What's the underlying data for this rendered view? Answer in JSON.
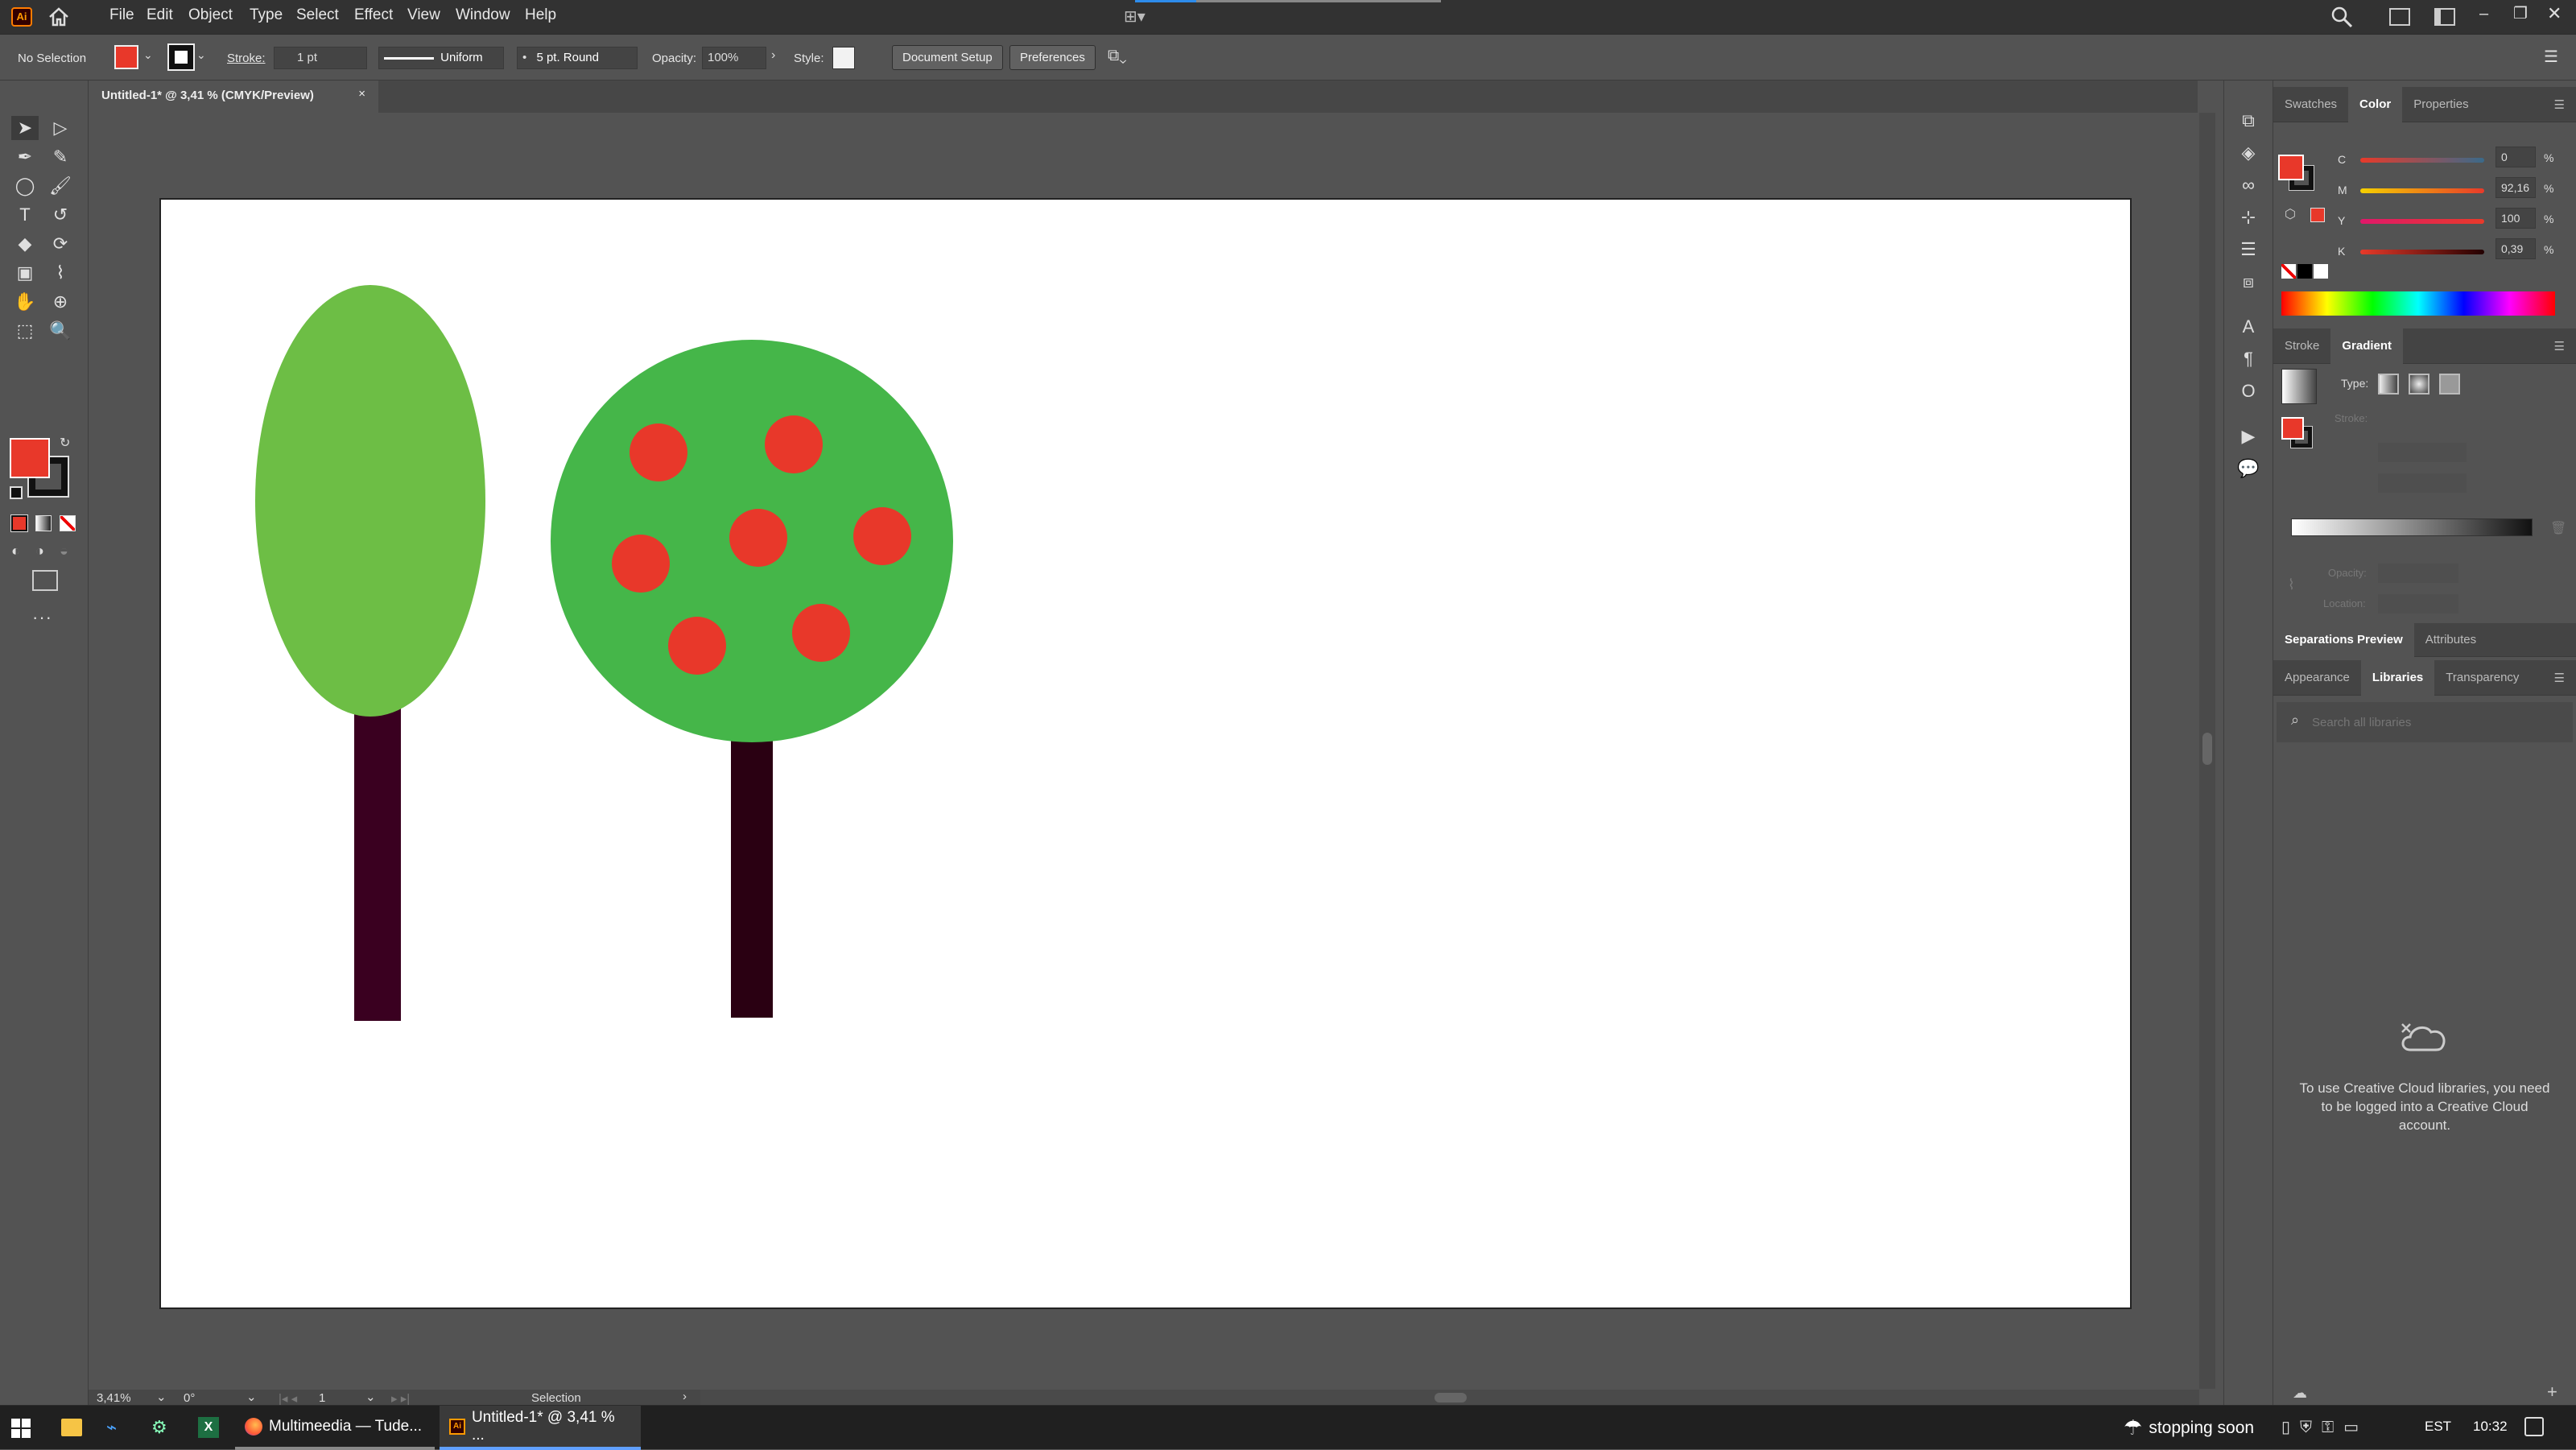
{
  "app": {
    "logo": "Ai"
  },
  "menu": [
    "File",
    "Edit",
    "Object",
    "Type",
    "Select",
    "Effect",
    "View",
    "Window",
    "Help"
  ],
  "control": {
    "selection": "No Selection",
    "stroke_label": "Stroke:",
    "stroke_value": "1 pt",
    "profile": "Uniform",
    "brush": "5 pt. Round",
    "opacity_label": "Opacity:",
    "opacity_value": "100%",
    "style_label": "Style:",
    "doc_setup": "Document Setup",
    "preferences": "Preferences"
  },
  "document": {
    "tab": "Untitled-1* @ 3,41 % (CMYK/Preview)"
  },
  "colors": {
    "fill": "#E8382A",
    "leaf_light": "#6DBE45",
    "leaf_dark": "#45B649",
    "trunk1": "#3A0020",
    "trunk2": "#2A0012",
    "fruit": "#E8382A"
  },
  "panels": {
    "top_tabs": [
      "Swatches",
      "Color",
      "Properties"
    ],
    "color": {
      "c": "0",
      "m": "92,16",
      "y": "100",
      "k": "0,39",
      "c_label": "C",
      "m_label": "M",
      "y_label": "Y",
      "k_label": "K",
      "pct": "%"
    },
    "mid_tabs": [
      "Stroke",
      "Gradient"
    ],
    "gradient": {
      "type_label": "Type:",
      "stroke_label": "Stroke:",
      "opacity_label": "Opacity:",
      "location_label": "Location:"
    },
    "sep_tabs": [
      "Separations Preview",
      "Attributes"
    ],
    "lib_tabs": [
      "Appearance",
      "Libraries",
      "Transparency"
    ],
    "lib_search_placeholder": "Search all libraries",
    "lib_message": "To use Creative Cloud libraries, you need to be logged into a Creative Cloud account."
  },
  "status": {
    "zoom": "3,41%",
    "rotation": "0°",
    "artboard": "1",
    "tool": "Selection"
  },
  "taskbar": {
    "firefox": "Multimeedia — Tude...",
    "illustrator": "Untitled-1* @ 3,41 % ...",
    "weather": "stopping soon",
    "lang": "EST",
    "time": "10:32"
  }
}
